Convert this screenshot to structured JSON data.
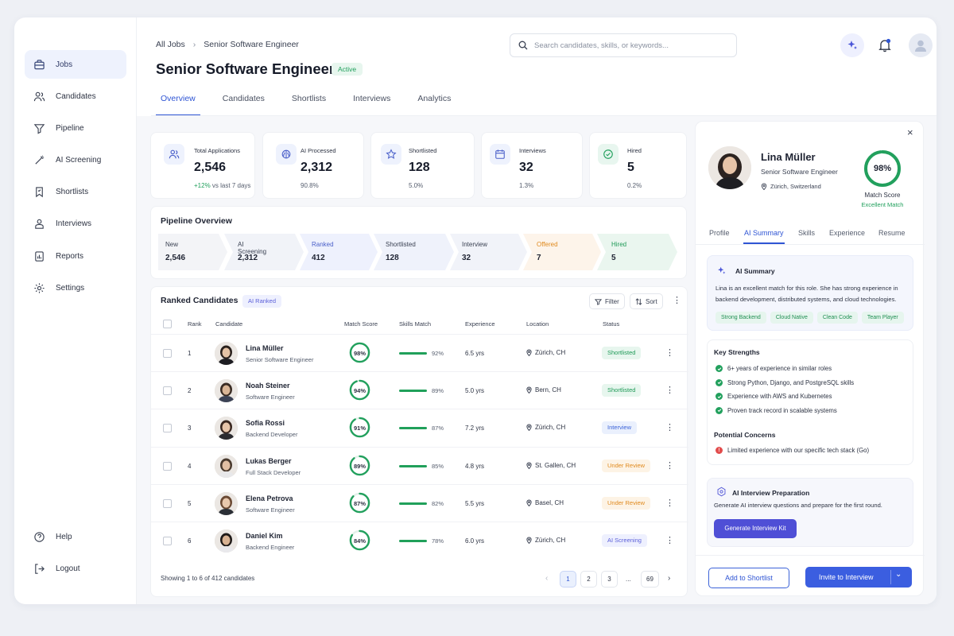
{
  "sidebar": {
    "items": [
      {
        "label": "Jobs",
        "icon": "briefcase-icon",
        "active": true
      },
      {
        "label": "Candidates",
        "icon": "users-icon"
      },
      {
        "label": "Pipeline",
        "icon": "filter-icon"
      },
      {
        "label": "AI Screening",
        "icon": "wand-icon"
      },
      {
        "label": "Shortlists",
        "icon": "bookmark-icon"
      },
      {
        "label": "Interviews",
        "icon": "interview-icon"
      },
      {
        "label": "Reports",
        "icon": "report-icon"
      },
      {
        "label": "Settings",
        "icon": "gear-icon"
      }
    ],
    "bottom": [
      {
        "label": "Help",
        "icon": "help-icon"
      },
      {
        "label": "Logout",
        "icon": "logout-icon"
      }
    ]
  },
  "header": {
    "breadcrumb": [
      "All Jobs",
      "Senior Software Engineer"
    ],
    "title": "Senior Software Engineer",
    "status": "Active",
    "search_placeholder": "Search candidates, skills, or keywords..."
  },
  "tabs": [
    "Overview",
    "Candidates",
    "Shortlists",
    "Interviews",
    "Analytics"
  ],
  "stats": [
    {
      "label": "Total Applications",
      "value": "2,546",
      "delta": "+12%",
      "sub": "vs last 7 days",
      "icon": "users-icon"
    },
    {
      "label": "AI Processed",
      "value": "2,312",
      "sub": "90.8%",
      "icon": "brain-icon"
    },
    {
      "label": "Shortlisted",
      "value": "128",
      "sub": "5.0%",
      "icon": "star-icon"
    },
    {
      "label": "Interviews",
      "value": "32",
      "sub": "1.3%",
      "icon": "calendar-icon"
    },
    {
      "label": "Hired",
      "value": "5",
      "sub": "0.2%",
      "icon": "check-circle-icon"
    }
  ],
  "pipeline": {
    "title": "Pipeline Overview",
    "stages": [
      {
        "name": "New",
        "value": "2,546",
        "color": "#f3f4f7",
        "text": "#3a4152"
      },
      {
        "name": "AI Screening",
        "value": "2,312",
        "color": "#f1f3f8",
        "text": "#3a4152"
      },
      {
        "name": "Ranked",
        "value": "412",
        "color": "#eef1fd",
        "text": "#4a5fc9"
      },
      {
        "name": "Shortlisted",
        "value": "128",
        "color": "#eff2fb",
        "text": "#3a4152"
      },
      {
        "name": "Interview",
        "value": "32",
        "color": "#f1f3f9",
        "text": "#3a4152"
      },
      {
        "name": "Offered",
        "value": "7",
        "color": "#fdf4ea",
        "text": "#e08a1e"
      },
      {
        "name": "Hired",
        "value": "5",
        "color": "#eaf6ef",
        "text": "#1f9a57"
      }
    ]
  },
  "ranked": {
    "title": "Ranked Candidates",
    "badge": "AI Ranked",
    "filter": "Filter",
    "sort": "Sort",
    "columns": [
      "Rank",
      "Candidate",
      "Match Score",
      "Skills Match",
      "Experience",
      "Location",
      "Status"
    ],
    "rows": [
      {
        "rank": "1",
        "name": "Lina Müller",
        "role": "Senior Software Engineer",
        "score": "98%",
        "score_value": 98,
        "skills": "92%",
        "experience": "6.5 yrs",
        "location": "Zürich, CH",
        "status": "Shortlisted",
        "status_type": "short"
      },
      {
        "rank": "2",
        "name": "Noah Steiner",
        "role": "Software Engineer",
        "score": "94%",
        "score_value": 94,
        "skills": "89%",
        "experience": "5.0 yrs",
        "location": "Bern, CH",
        "status": "Shortlisted",
        "status_type": "short"
      },
      {
        "rank": "3",
        "name": "Sofia Rossi",
        "role": "Backend Developer",
        "score": "91%",
        "score_value": 91,
        "skills": "87%",
        "experience": "7.2 yrs",
        "location": "Zürich, CH",
        "status": "Interview",
        "status_type": "int"
      },
      {
        "rank": "4",
        "name": "Lukas Berger",
        "role": "Full Stack Developer",
        "score": "89%",
        "score_value": 89,
        "skills": "85%",
        "experience": "4.8 yrs",
        "location": "St. Gallen, CH",
        "status": "Under Review",
        "status_type": "rev"
      },
      {
        "rank": "5",
        "name": "Elena Petrova",
        "role": "Software Engineer",
        "score": "87%",
        "score_value": 87,
        "skills": "82%",
        "experience": "5.5 yrs",
        "location": "Basel, CH",
        "status": "Under Review",
        "status_type": "rev"
      },
      {
        "rank": "6",
        "name": "Daniel Kim",
        "role": "Backend Engineer",
        "score": "84%",
        "score_value": 84,
        "skills": "78%",
        "experience": "6.0 yrs",
        "location": "Zürich, CH",
        "status": "AI Screening",
        "status_type": "ai"
      }
    ],
    "footer": "Showing 1 to 6 of 412 candidates",
    "pages": [
      "1",
      "2",
      "3",
      "...",
      "69"
    ]
  },
  "panel": {
    "name": "Lina Müller",
    "role": "Senior Software Engineer",
    "location": "Zürich, Switzerland",
    "score": "98%",
    "score_label": "Match Score",
    "score_sub": "Excellent Match",
    "tabs": [
      "Profile",
      "AI Summary",
      "Skills",
      "Experience",
      "Resume"
    ],
    "summary_title": "AI Summary",
    "summary_text": "Lina is an excellent match for this role. She has strong experience in backend development, distributed systems, and cloud technologies.",
    "tags": [
      "Strong Backend",
      "Cloud Native",
      "Clean Code",
      "Team Player"
    ],
    "strengths_title": "Key Strengths",
    "strengths": [
      "6+ years of experience in similar roles",
      "Strong Python, Django, and PostgreSQL skills",
      "Experience with AWS and Kubernetes",
      "Proven track record in scalable systems"
    ],
    "concerns_title": "Potential Concerns",
    "concerns": [
      "Limited experience with our specific tech stack (Go)"
    ],
    "prep_title": "AI Interview Preparation",
    "prep_text": "Generate AI interview questions and prepare for the first round.",
    "prep_button": "Generate Interview Kit",
    "shortlist_button": "Add to Shortlist",
    "invite_button": "Invite to Interview"
  }
}
